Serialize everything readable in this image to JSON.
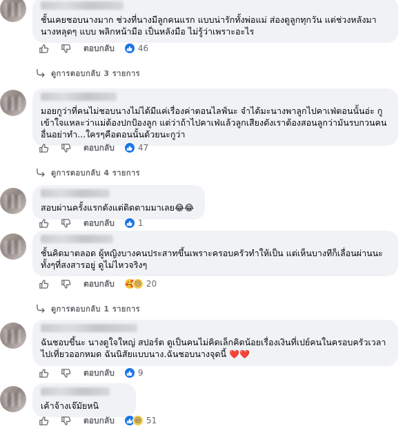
{
  "ui": {
    "reply_label": "ตอบกลับ"
  },
  "comments": [
    {
      "text": "ชั้นเคยชอบนางมาก ช่วงที่นางมีลูกคนแรก แบบน่ารักทั้งพ่อแม่ ส่องดูลูกทุกวัน แต่ช่วงหลังมา นางหลุดๆ แบบ พลิกหน้ามือ เป็นหลังมือ ไม่รู้ว่าเพราะอะไร",
      "reactions": [
        "like"
      ],
      "reaction_count": "46",
      "replies_link": "ดูการตอบกลับ 3 รายการ"
    },
    {
      "text": "มอยกูว่าที่คนไม่ชอบนางไม่ได้มีแค่เรื่องค่าตอนไลฟ์นะ จำได้มะนางพาลูกไปคาเฟ่ตอนนั้นอ่ะ กูเข้าใจแหละว่าแม่ต้องปกป้องลูก แต่ว่าถ้าไปคาเฟ่แล้วลูกเสียงดังเราต้องสอนลูกว่ามันรบกวนคนอื่นอย่าทำ...ใครๆคือตอนนั้นด้วยนะกูว่า",
      "reactions": [
        "like"
      ],
      "reaction_count": "47",
      "replies_link": "ดูการตอบกลับ 4 รายการ"
    },
    {
      "text": "สอบผ่านครั้งแรกดังแต่ติดตามมาเลย",
      "emojis": [
        "😂",
        "😂"
      ],
      "reactions": [
        "like"
      ],
      "reaction_count": "1"
    },
    {
      "text": "ชั้นคิดมาตลอด ผู้หญิงบางคนประสาทขึ้นเพราะครอบครัวทำให้เป็น แต่เห็นบางทีก็เลื่อนผ่านนะ ทั้งๆที่สงสารอยู่ ดูไม่ไหวจริงๆ",
      "reactions": [
        "care",
        "sad"
      ],
      "reaction_count": "20",
      "replies_link": "ดูการตอบกลับ 1 รายการ"
    },
    {
      "text": "ฉันชอบขึ้นะ นางดูใจใหญ่ สปอร์ต ดูเป็นคนไม่คิดเล็กคิดน้อยเรื่องเงินที่เปย์คนในครอบครัวเวลาไปเที่ยวออกหมด ฉันนิสัยแบบนาง.ฉันชอบนางจุดนี้",
      "emojis": [
        "❤️",
        "❤️"
      ],
      "reactions": [
        "like"
      ],
      "reaction_count": "9"
    },
    {
      "text": "เค้าจ้างเจ๊มัยหนิ",
      "reactions": [
        "like",
        "haha"
      ],
      "reaction_count": "51"
    }
  ]
}
